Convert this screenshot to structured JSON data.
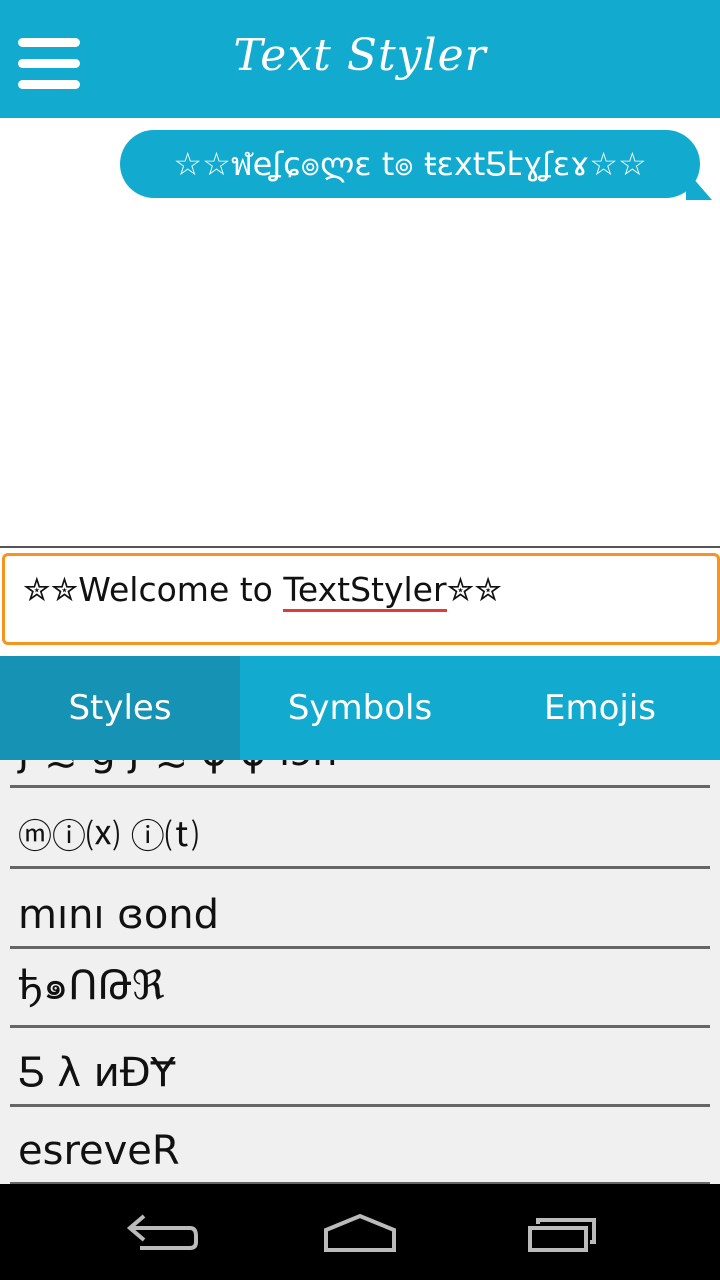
{
  "app": {
    "title": "Text Styler"
  },
  "chat": {
    "message": "☆☆ฬeʆɕ๏ლε t๏ ŧεxtƼէɣʆεɤ☆☆"
  },
  "input": {
    "value_prefix": "✮✮Welcome to ",
    "value_misspelled": "TextStyler",
    "value_suffix": "✮✮"
  },
  "tabs": [
    {
      "label": "Styles",
      "active": true
    },
    {
      "label": "Symbols",
      "active": false
    },
    {
      "label": "Emojis",
      "active": false
    }
  ],
  "styles_list": [
    {
      "text": "ʃ ≾ ց ʃ ≾ ɸ ɸ ıɔn"
    },
    {
      "text": "ⓜⓘ⒳ ⓘ⒯"
    },
    {
      "text": "mını ɞond"
    },
    {
      "text": "ђ๑ՈԹℜ"
    },
    {
      "text": "Ƽ λ иÐɎ"
    },
    {
      "text": "esreveR"
    }
  ],
  "colors": {
    "primary": "#12abcf",
    "primary_dark": "#1592b4",
    "input_border": "#f7931e",
    "list_bg": "#f0f0f0"
  },
  "icons": [
    "menu-icon",
    "back-icon",
    "home-icon",
    "recents-icon"
  ]
}
